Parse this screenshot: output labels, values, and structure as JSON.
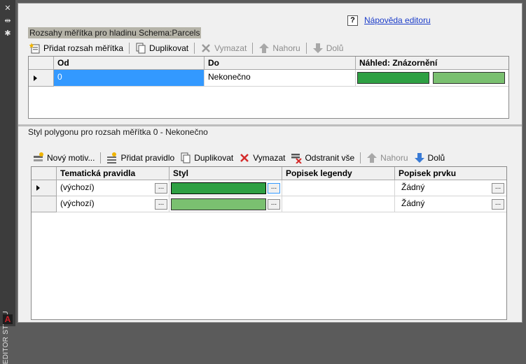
{
  "sidebar": {
    "title": "EDITOR STYLU",
    "icons": [
      "close-icon",
      "pin-icon",
      "settings-icon"
    ],
    "logo": "A"
  },
  "help": {
    "icon": "?",
    "link": "Nápověda editoru"
  },
  "scale_ranges": {
    "title": "Rozsahy měřítka pro hladinu Schema:Parcels",
    "toolbar": {
      "add": "Přidat rozsah měřítka",
      "duplicate": "Duplikovat",
      "delete": "Vymazat",
      "up": "Nahoru",
      "down": "Dolů"
    },
    "columns": {
      "from": "Od",
      "to": "Do",
      "preview": "Náhled: Znázornění"
    },
    "rows": [
      {
        "from": "0",
        "to": "Nekonečno",
        "preview_colors": [
          "#2ea043",
          "#7ac070"
        ]
      }
    ]
  },
  "polygon_style": {
    "title": "Styl polygonu pro rozsah měřítka 0 - Nekonečno",
    "toolbar": {
      "new_theme": "Nový motiv...",
      "add_rule": "Přidat pravidlo",
      "duplicate": "Duplikovat",
      "delete": "Vymazat",
      "remove_all": "Odstranit vše",
      "up": "Nahoru",
      "down": "Dolů"
    },
    "columns": {
      "rules": "Tematická pravidla",
      "style": "Styl",
      "legend": "Popisek legendy",
      "feature": "Popisek prvku"
    },
    "rows": [
      {
        "rule": "(výchozí)",
        "style_color": "#2ea043",
        "legend": "",
        "feature": "Žádný"
      },
      {
        "rule": "(výchozí)",
        "style_color": "#7ac070",
        "legend": "",
        "feature": "Žádný"
      }
    ],
    "ellipsis": "..."
  },
  "colors": {
    "selection": "#3399ff",
    "link": "#1b3cc9"
  }
}
